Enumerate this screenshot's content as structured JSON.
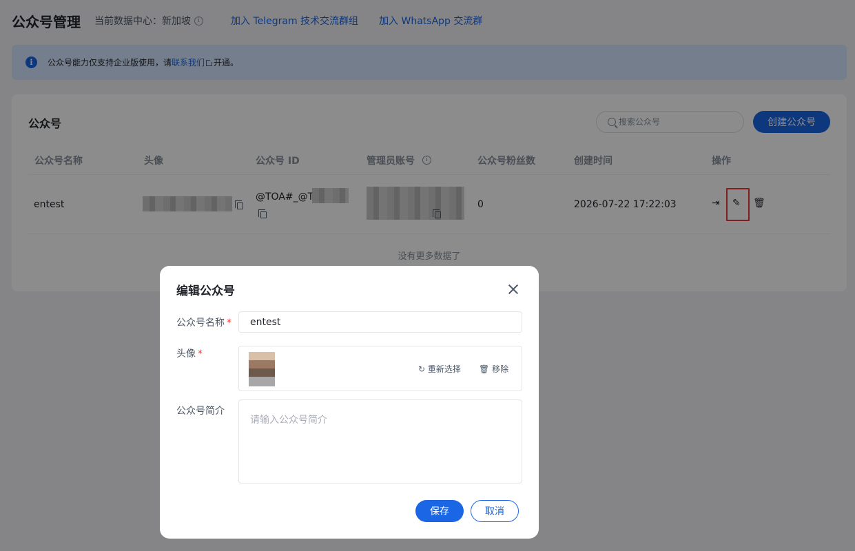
{
  "header": {
    "title": "公众号管理",
    "data_center": "当前数据中心：新加坡",
    "telegram_link": "加入 Telegram 技术交流群组",
    "whatsapp_link": "加入 WhatsApp 交流群"
  },
  "notice": {
    "text_before": "公众号能力仅支持企业版使用，请",
    "link": "联系我们",
    "text_after": "开通。"
  },
  "card": {
    "title": "公众号",
    "search_placeholder": "搜索公众号",
    "create_button": "创建公众号",
    "columns": [
      "公众号名称",
      "头像",
      "公众号 ID",
      "管理员账号",
      "公众号粉丝数",
      "创建时间",
      "操作"
    ],
    "row": {
      "name": "entest",
      "id_prefix": "@TOA#_@TC",
      "fans": "0",
      "created": "2026-07-22 17:22:03"
    },
    "empty_text": "没有更多数据了"
  },
  "dialog": {
    "title": "编辑公众号",
    "name_label": "公众号名称",
    "name_value": "entest",
    "avatar_label": "头像",
    "reselect": "重新选择",
    "remove": "移除",
    "desc_label": "公众号简介",
    "desc_placeholder": "请输入公众号简介",
    "save": "保存",
    "cancel": "取消"
  },
  "icons": {
    "info": "info-icon",
    "copy": "copy-icon",
    "login": "login-icon",
    "edit": "edit-icon",
    "delete": "trash-icon",
    "search": "search-icon",
    "close": "close-icon",
    "refresh": "refresh-icon"
  },
  "colors": {
    "accent": "#1a66e4",
    "notice_bg": "#d6e6ff",
    "required": "#e53935"
  }
}
